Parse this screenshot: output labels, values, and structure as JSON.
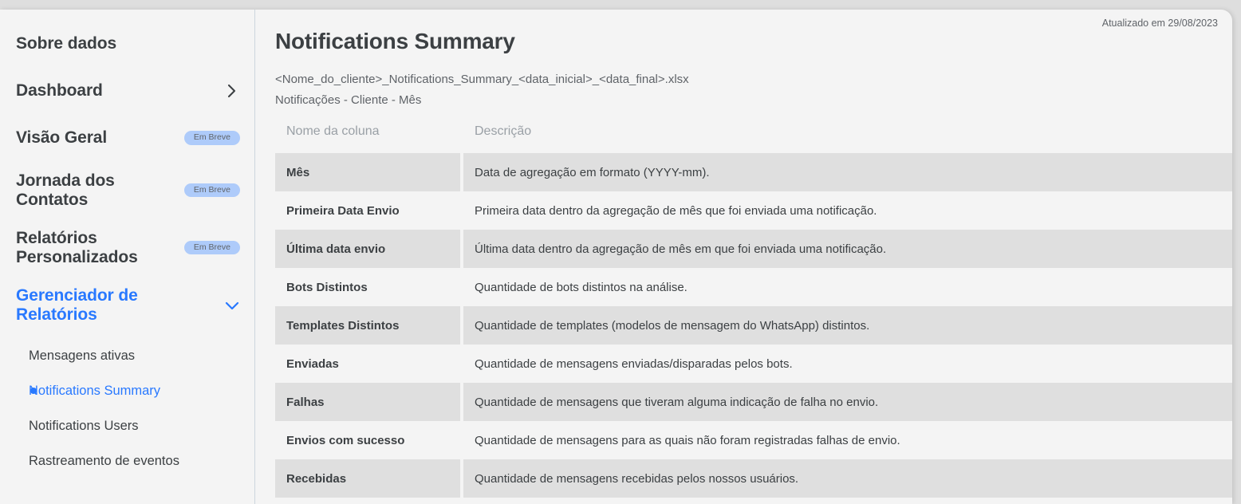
{
  "sidebar": {
    "top_items": [
      {
        "label": "Sobre dados",
        "badge": null,
        "chevron": null,
        "accent": false
      },
      {
        "label": "Dashboard",
        "badge": null,
        "chevron": "chevron-right",
        "accent": false
      },
      {
        "label": "Visão Geral",
        "badge": "Em Breve",
        "chevron": null,
        "accent": false
      },
      {
        "label": "Jornada dos Contatos",
        "badge": "Em Breve",
        "chevron": null,
        "accent": false
      },
      {
        "label": "Relatórios Personalizados",
        "badge": "Em Breve",
        "chevron": null,
        "accent": false
      },
      {
        "label": "Gerenciador de Relatórios",
        "badge": null,
        "chevron": "chevron-down",
        "accent": true
      }
    ],
    "sub_items": [
      {
        "label": "Mensagens ativas",
        "active": false
      },
      {
        "label": "Notifications Summary",
        "active": true
      },
      {
        "label": "Notifications Users",
        "active": false
      },
      {
        "label": "Rastreamento de eventos",
        "active": false
      }
    ]
  },
  "header": {
    "updated_label": "Atualizado em 29/08/2023",
    "title": "Notifications Summary",
    "file_pattern": "<Nome_do_cliente>_Notifications_Summary_<data_inicial>_<data_final>.xlsx",
    "report_scope": "Notificações - Cliente - Mês"
  },
  "table": {
    "columns": [
      "Nome da coluna",
      "Descrição"
    ],
    "rows": [
      {
        "name": "Mês",
        "description": "Data de agregação em formato (YYYY-mm)."
      },
      {
        "name": "Primeira Data Envio",
        "description": "Primeira data dentro da agregação de mês que foi enviada uma notificação."
      },
      {
        "name": "Última data envio",
        "description": "Última data dentro da agregação de mês em que foi enviada uma notificação."
      },
      {
        "name": "Bots Distintos",
        "description": "Quantidade de bots distintos na análise."
      },
      {
        "name": "Templates Distintos",
        "description": "Quantidade de templates (modelos de mensagem do WhatsApp) distintos."
      },
      {
        "name": "Enviadas",
        "description": "Quantidade de mensagens enviadas/disparadas pelos bots."
      },
      {
        "name": "Falhas",
        "description": "Quantidade de mensagens que tiveram alguma indicação de falha no envio."
      },
      {
        "name": "Envios com sucesso",
        "description": "Quantidade de mensagens para as quais não foram registradas falhas de envio."
      },
      {
        "name": "Recebidas",
        "description": "Quantidade de mensagens recebidas pelos nossos usuários."
      }
    ]
  },
  "colors": {
    "accent": "#2979ff",
    "badge_bg": "#aecbfa",
    "badge_text": "#5f6368",
    "row_shaded": "#dfdfdf",
    "card_bg": "#f4f4f4",
    "page_bg": "#dedede",
    "text_primary": "#3c4043",
    "text_muted": "#9aa0a6"
  }
}
